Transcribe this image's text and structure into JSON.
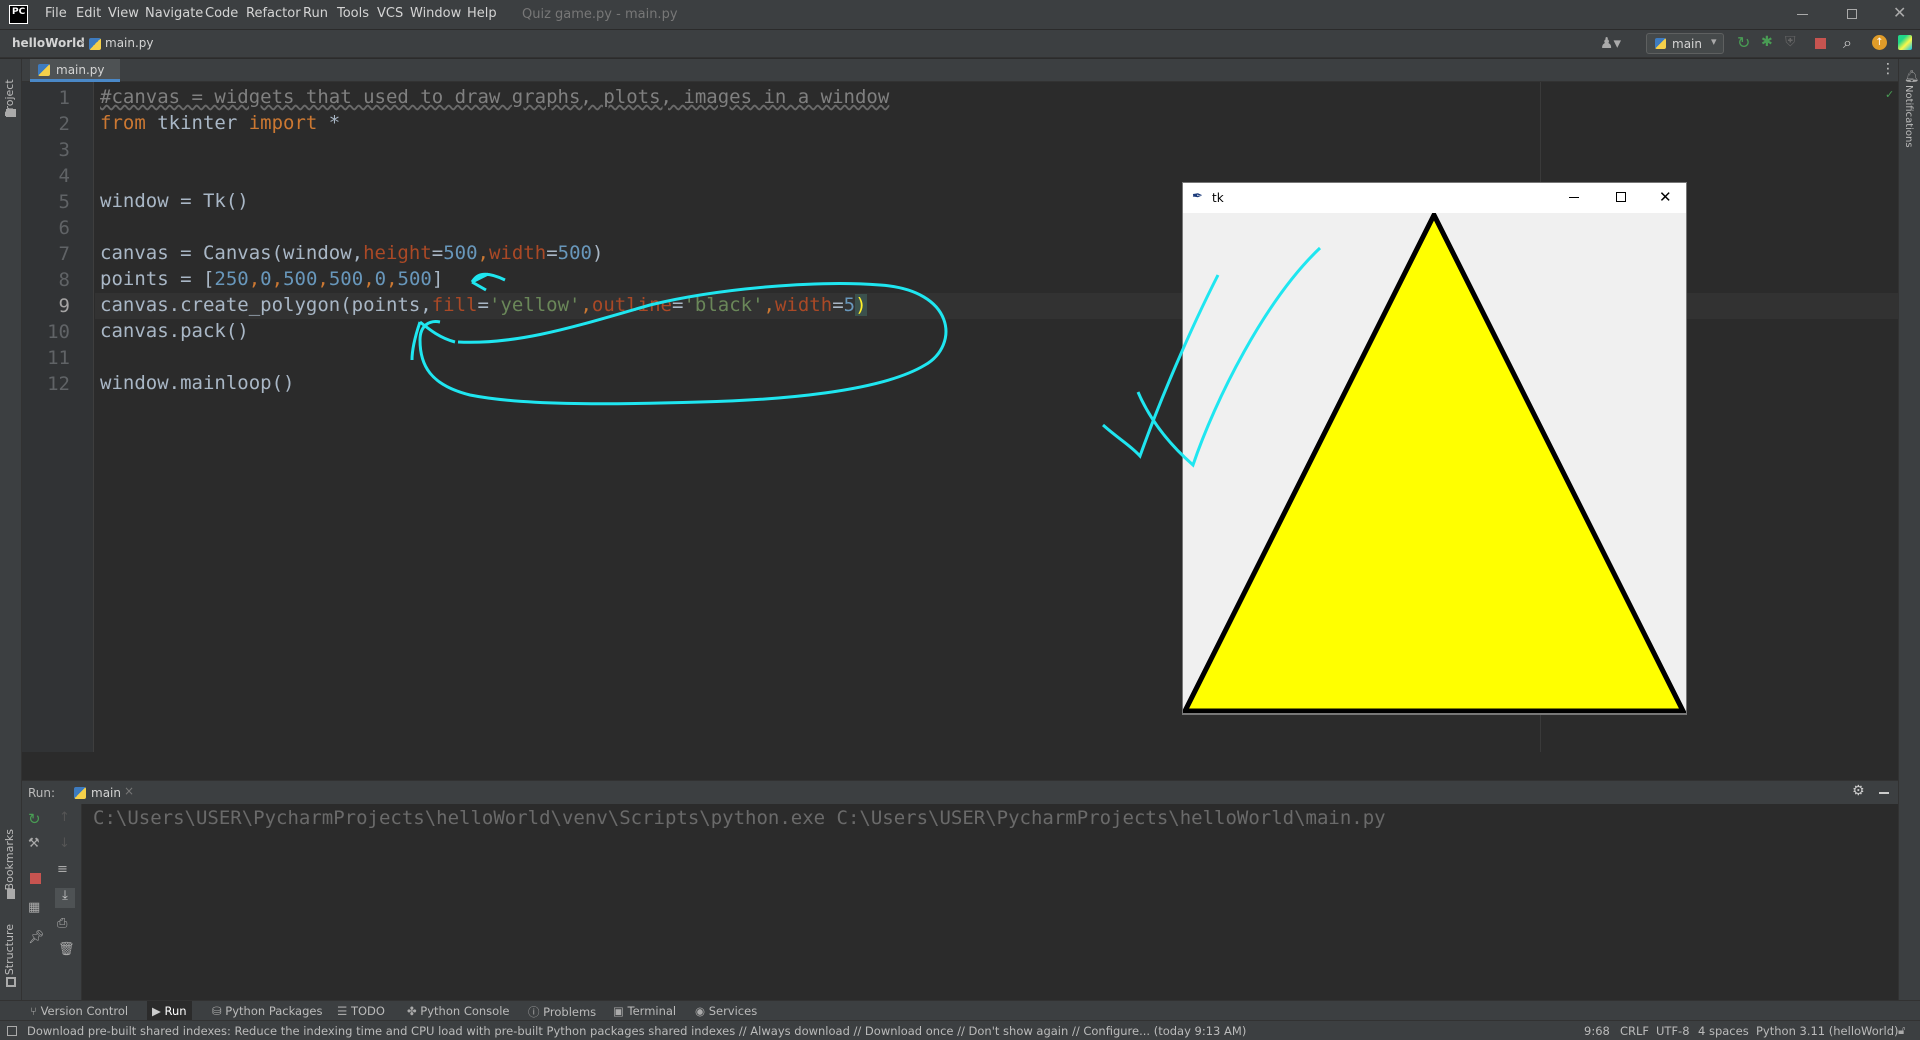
{
  "window": {
    "app_logo": "PC",
    "title": "Quiz game.py - main.py"
  },
  "menu": [
    "File",
    "Edit",
    "View",
    "Navigate",
    "Code",
    "Refactor",
    "Run",
    "Tools",
    "VCS",
    "Window",
    "Help"
  ],
  "breadcrumb": {
    "project": "helloWorld",
    "file": "main.py"
  },
  "run_config": "main",
  "editor_tab": "main.py",
  "side_tools": {
    "project": "Project",
    "bookmarks": "Bookmarks",
    "structure": "Structure",
    "notifications": "Notifications"
  },
  "code": {
    "line_numbers": [
      "1",
      "2",
      "3",
      "4",
      "5",
      "6",
      "7",
      "8",
      "9",
      "10",
      "11",
      "12"
    ],
    "line1": "#canvas = widgets that used to draw graphs, plots, images in a window",
    "line2": {
      "from": "from",
      "module": " tkinter ",
      "import": "import",
      "star": " *"
    },
    "line5": "window = Tk()",
    "line7": {
      "a": "canvas = Canvas(window,",
      "p1": "height",
      "eq1": "=",
      "v1": "500",
      "c1": ",",
      "p2": "width",
      "eq2": "=",
      "v2": "500",
      "end": ")"
    },
    "line8": {
      "a": "points = [",
      "n1": "250",
      "c1": ",",
      "n2": "0",
      "c2": ",",
      "n3": "500",
      "c3": ",",
      "n4": "500",
      "c4": ",",
      "n5": "0",
      "c5": ",",
      "n6": "500",
      "end": "]"
    },
    "line9": {
      "a": "canvas.create_polygon(points,",
      "p1": "fill",
      "eq1": "=",
      "s1": "'yellow'",
      "c1": ",",
      "p2": "outline",
      "eq2": "=",
      "s2": "'black'",
      "c2": ",",
      "p3": "width",
      "eq3": "=",
      "v3": "5",
      "end": ")"
    },
    "line10": "canvas.pack()",
    "line12": "window.mainloop()"
  },
  "run_panel": {
    "label": "Run:",
    "tab": "main",
    "output": "C:\\Users\\USER\\PycharmProjects\\helloWorld\\venv\\Scripts\\python.exe C:\\Users\\USER\\PycharmProjects\\helloWorld\\main.py"
  },
  "tk_window": {
    "title": "tk",
    "polygon": {
      "points": [
        250,
        0,
        500,
        500,
        0,
        500
      ],
      "fill": "#ffff00",
      "outline": "#000000",
      "width": 5
    }
  },
  "bottom_tabs": [
    "Version Control",
    "Run",
    "Python Packages",
    "TODO",
    "Python Console",
    "Problems",
    "Terminal",
    "Services"
  ],
  "status": {
    "message": "Download pre-built shared indexes: Reduce the indexing time and CPU load with pre-built Python packages shared indexes // Always download // Download once // Don't show again // Configure... (today 9:13 AM)",
    "position": "9:68",
    "line_sep": "CRLF",
    "encoding": "UTF-8",
    "indent": "4 spaces",
    "interpreter": "Python 3.11 (helloWorld)"
  },
  "colors": {
    "accent_annotation": "#1fe6f0",
    "run_green": "#499c54",
    "stop_red": "#c75450"
  }
}
